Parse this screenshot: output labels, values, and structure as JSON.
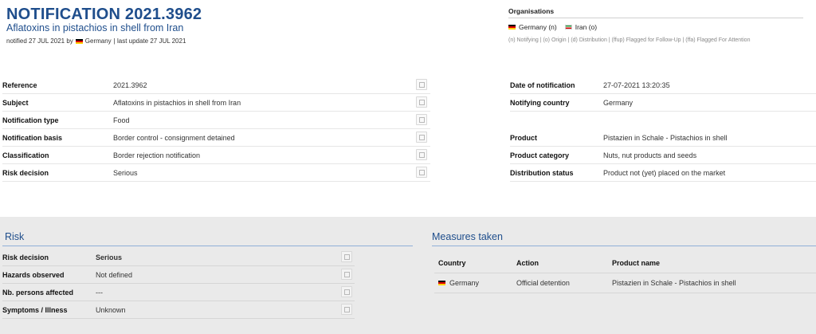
{
  "header": {
    "title": "NOTIFICATION 2021.3962",
    "subtitle": "Aflatoxins in pistachios in shell from Iran",
    "notified_prefix": "notified 27 JUL 2021 by",
    "notified_country": "Germany",
    "last_update": "| last update 27 JUL 2021"
  },
  "organisations": {
    "title": "Organisations",
    "items": [
      {
        "label": "Germany (n)",
        "flag": "de-flag"
      },
      {
        "label": "Iran (o)",
        "flag": "ir-flag"
      }
    ],
    "legend": "(n) Notifying | (o) Origin | (d) Distribution | (ffup) Flagged for Follow-Up | (ffa) Flagged For Attention"
  },
  "details_left": [
    {
      "label": "Reference",
      "value": "2021.3962"
    },
    {
      "label": "Subject",
      "value": "Aflatoxins in pistachios in shell from Iran"
    },
    {
      "label": "Notification type",
      "value": "Food"
    },
    {
      "label": "Notification basis",
      "value": "Border control - consignment detained"
    },
    {
      "label": "Classification",
      "value": "Border rejection notification"
    },
    {
      "label": "Risk decision",
      "value": "Serious"
    }
  ],
  "details_right": [
    {
      "label": "Date of notification",
      "value": "27-07-2021 13:20:35"
    },
    {
      "label": "Notifying country",
      "value": "Germany"
    },
    {
      "label": "Product",
      "value": "Pistazien in Schale - Pistachios in shell"
    },
    {
      "label": "Product category",
      "value": "Nuts, nut products and seeds"
    },
    {
      "label": "Distribution status",
      "value": "Product not (yet) placed on the market"
    }
  ],
  "risk": {
    "heading": "Risk",
    "rows": [
      {
        "label": "Risk decision",
        "value": "Serious"
      },
      {
        "label": "Hazards observed",
        "value": "Not defined"
      },
      {
        "label": "Nb. persons affected",
        "value": "---"
      },
      {
        "label": "Symptoms / Illness",
        "value": "Unknown"
      }
    ]
  },
  "measures": {
    "heading": "Measures taken",
    "columns": [
      "Country",
      "Action",
      "Product name"
    ],
    "rows": [
      {
        "country": "Germany",
        "action": "Official detention",
        "product": "Pistazien in Schale - Pistachios in shell"
      }
    ]
  },
  "colors": {
    "title_blue": "#1f4e8c",
    "serious_red": "#c0392b",
    "section_bg": "#eaeaea"
  }
}
